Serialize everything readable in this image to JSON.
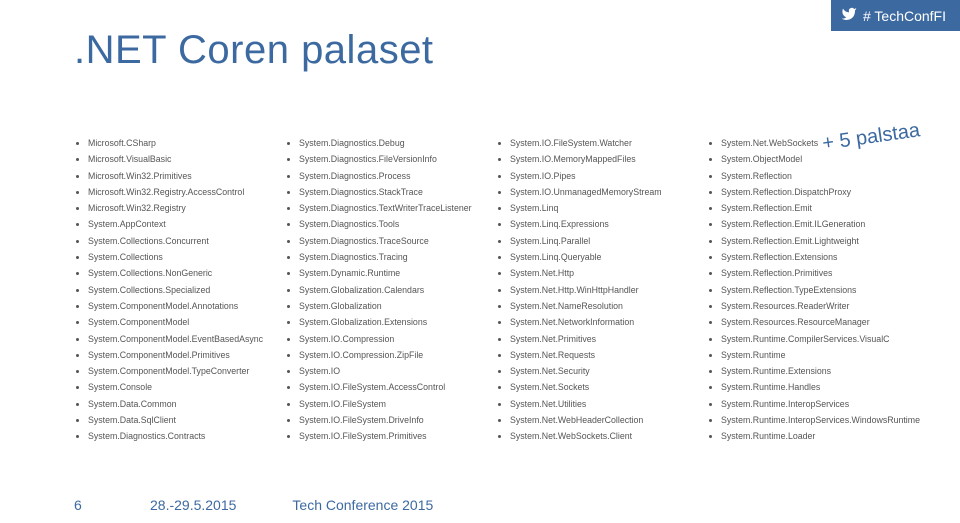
{
  "hashtag": "# TechConfFI",
  "title": ".NET Coren palaset",
  "annotation": "+ 5 palstaa",
  "columns": [
    [
      "Microsoft.CSharp",
      "Microsoft.VisualBasic",
      "Microsoft.Win32.Primitives",
      "Microsoft.Win32.Registry.AccessControl",
      "Microsoft.Win32.Registry",
      "System.AppContext",
      "System.Collections.Concurrent",
      "System.Collections",
      "System.Collections.NonGeneric",
      "System.Collections.Specialized",
      "System.ComponentModel.Annotations",
      "System.ComponentModel",
      "System.ComponentModel.EventBasedAsync",
      "System.ComponentModel.Primitives",
      "System.ComponentModel.TypeConverter",
      "System.Console",
      "System.Data.Common",
      "System.Data.SqlClient",
      "System.Diagnostics.Contracts"
    ],
    [
      "System.Diagnostics.Debug",
      "System.Diagnostics.FileVersionInfo",
      "System.Diagnostics.Process",
      "System.Diagnostics.StackTrace",
      "System.Diagnostics.TextWriterTraceListener",
      "System.Diagnostics.Tools",
      "System.Diagnostics.TraceSource",
      "System.Diagnostics.Tracing",
      "System.Dynamic.Runtime",
      "System.Globalization.Calendars",
      "System.Globalization",
      "System.Globalization.Extensions",
      "System.IO.Compression",
      "System.IO.Compression.ZipFile",
      "System.IO",
      "System.IO.FileSystem.AccessControl",
      "System.IO.FileSystem",
      "System.IO.FileSystem.DriveInfo",
      "System.IO.FileSystem.Primitives"
    ],
    [
      "System.IO.FileSystem.Watcher",
      "System.IO.MemoryMappedFiles",
      "System.IO.Pipes",
      "System.IO.UnmanagedMemoryStream",
      "System.Linq",
      "System.Linq.Expressions",
      "System.Linq.Parallel",
      "System.Linq.Queryable",
      "System.Net.Http",
      "System.Net.Http.WinHttpHandler",
      "System.Net.NameResolution",
      "System.Net.NetworkInformation",
      "System.Net.Primitives",
      "System.Net.Requests",
      "System.Net.Security",
      "System.Net.Sockets",
      "System.Net.Utilities",
      "System.Net.WebHeaderCollection",
      "System.Net.WebSockets.Client"
    ],
    [
      "System.Net.WebSockets",
      "System.ObjectModel",
      "System.Reflection",
      "System.Reflection.DispatchProxy",
      "System.Reflection.Emit",
      "System.Reflection.Emit.ILGeneration",
      "System.Reflection.Emit.Lightweight",
      "System.Reflection.Extensions",
      "System.Reflection.Primitives",
      "System.Reflection.TypeExtensions",
      "System.Resources.ReaderWriter",
      "System.Resources.ResourceManager",
      "System.Runtime.CompilerServices.VisualC",
      "System.Runtime",
      "System.Runtime.Extensions",
      "System.Runtime.Handles",
      "System.Runtime.InteropServices",
      "System.Runtime.InteropServices.WindowsRuntime",
      "System.Runtime.Loader"
    ]
  ],
  "footer": {
    "page": "6",
    "date": "28.-29.5.2015",
    "event": "Tech Conference 2015"
  }
}
